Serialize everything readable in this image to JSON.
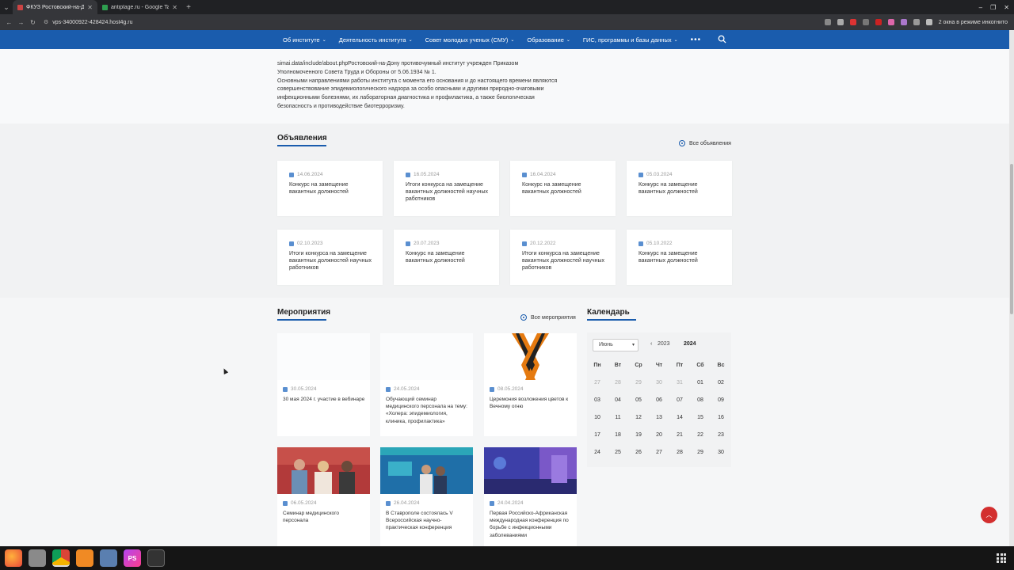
{
  "browser": {
    "tabs": [
      {
        "title": "ФКУЗ Ростовский-на-Д",
        "active": true,
        "color": "#c44"
      },
      {
        "title": "antiplage.ru - Google Tab",
        "active": false,
        "color": "#2e9e4f"
      }
    ],
    "url": "vps-34000922-428424.host4g.ru",
    "incognito_text": "2 окна в режиме инкогнито"
  },
  "nav": {
    "items": [
      {
        "label": "Об институте"
      },
      {
        "label": "Деятельность института"
      },
      {
        "label": "Совет молодых ученых (СМУ)"
      },
      {
        "label": "Образование"
      },
      {
        "label": "ГИС, программы и базы данных"
      }
    ],
    "more": "•••"
  },
  "about": {
    "lines": [
      "simai.data/include/about.phpРостовский-на-Дону противочумный институт учрежден Приказом",
      "Уполномоченного Совета Труда и Обороны от 5.06.1934 № 1.",
      "Основными направлениями работы института с момента его основания и до настоящего времени являются",
      "совершенствование эпидемиологического надзора за особо опасными и другими природно-очаговыми",
      "инфекционными болезнями, их лабораторная диагностика и профилактика, а также биологическая",
      "безопасность и противодействие биотерроризму."
    ]
  },
  "announcements": {
    "title": "Объявления",
    "all_link": "Все объявления",
    "items": [
      {
        "date": "14.06.2024",
        "text": "Конкурс на замещение вакантных должностей"
      },
      {
        "date": "16.05.2024",
        "text": "Итоги конкурса на замещение вакантных должностей научных работников"
      },
      {
        "date": "16.04.2024",
        "text": "Конкурс на замещение вакантных должностей"
      },
      {
        "date": "05.03.2024",
        "text": "Конкурс на замещение вакантных должностей"
      },
      {
        "date": "02.10.2023",
        "text": "Итоги конкурса на замещение вакантных должностей научных работников"
      },
      {
        "date": "20.07.2023",
        "text": "Конкурс на замещение вакантных должностей"
      },
      {
        "date": "20.12.2022",
        "text": "Итоги конкурса на замещение вакантных должностей научных работников"
      },
      {
        "date": "05.10.2022",
        "text": "Конкурс на замещение вакантных должностей"
      }
    ]
  },
  "events": {
    "title": "Мероприятия",
    "all_link": "Все мероприятия",
    "items": [
      {
        "date": "30.05.2024",
        "text": "30 мая 2024 г. участие в вебинаре"
      },
      {
        "date": "24.05.2024",
        "text": "Обучающий семинар медицинского персонала на тему: «Холера: эпидемиология, клиника, профилактика»"
      },
      {
        "date": "08.05.2024",
        "text": "Церемония возложения цветов к Вечному огню"
      },
      {
        "date": "06.05.2024",
        "text": "Семинар медицинского персонала"
      },
      {
        "date": "26.04.2024",
        "text": "В Ставрополе состоялась V Всероссийская научно-практическая конференция"
      },
      {
        "date": "24.04.2024",
        "text": "Первая Российско-Африканская международная конференция по борьбе с инфекционными заболеваниями"
      }
    ]
  },
  "calendar": {
    "title": "Календарь",
    "month": "Июнь",
    "prev_year": "2023",
    "year": "2024",
    "weekdays": [
      "Пн",
      "Вт",
      "Ср",
      "Чт",
      "Пт",
      "Сб",
      "Вс"
    ],
    "weeks": [
      [
        "27",
        "28",
        "29",
        "30",
        "31",
        "01",
        "02"
      ],
      [
        "03",
        "04",
        "05",
        "06",
        "07",
        "08",
        "09"
      ],
      [
        "10",
        "11",
        "12",
        "13",
        "14",
        "15",
        "16"
      ],
      [
        "17",
        "18",
        "19",
        "20",
        "21",
        "22",
        "23"
      ],
      [
        "24",
        "25",
        "26",
        "27",
        "28",
        "29",
        "30"
      ]
    ]
  },
  "taskbar": {
    "apps": [
      "firefox-icon",
      "files-icon",
      "chrome-icon",
      "sublime-icon",
      "app-icon",
      "phpstorm-icon",
      "terminal-icon"
    ],
    "phpstorm_label": "PS"
  }
}
